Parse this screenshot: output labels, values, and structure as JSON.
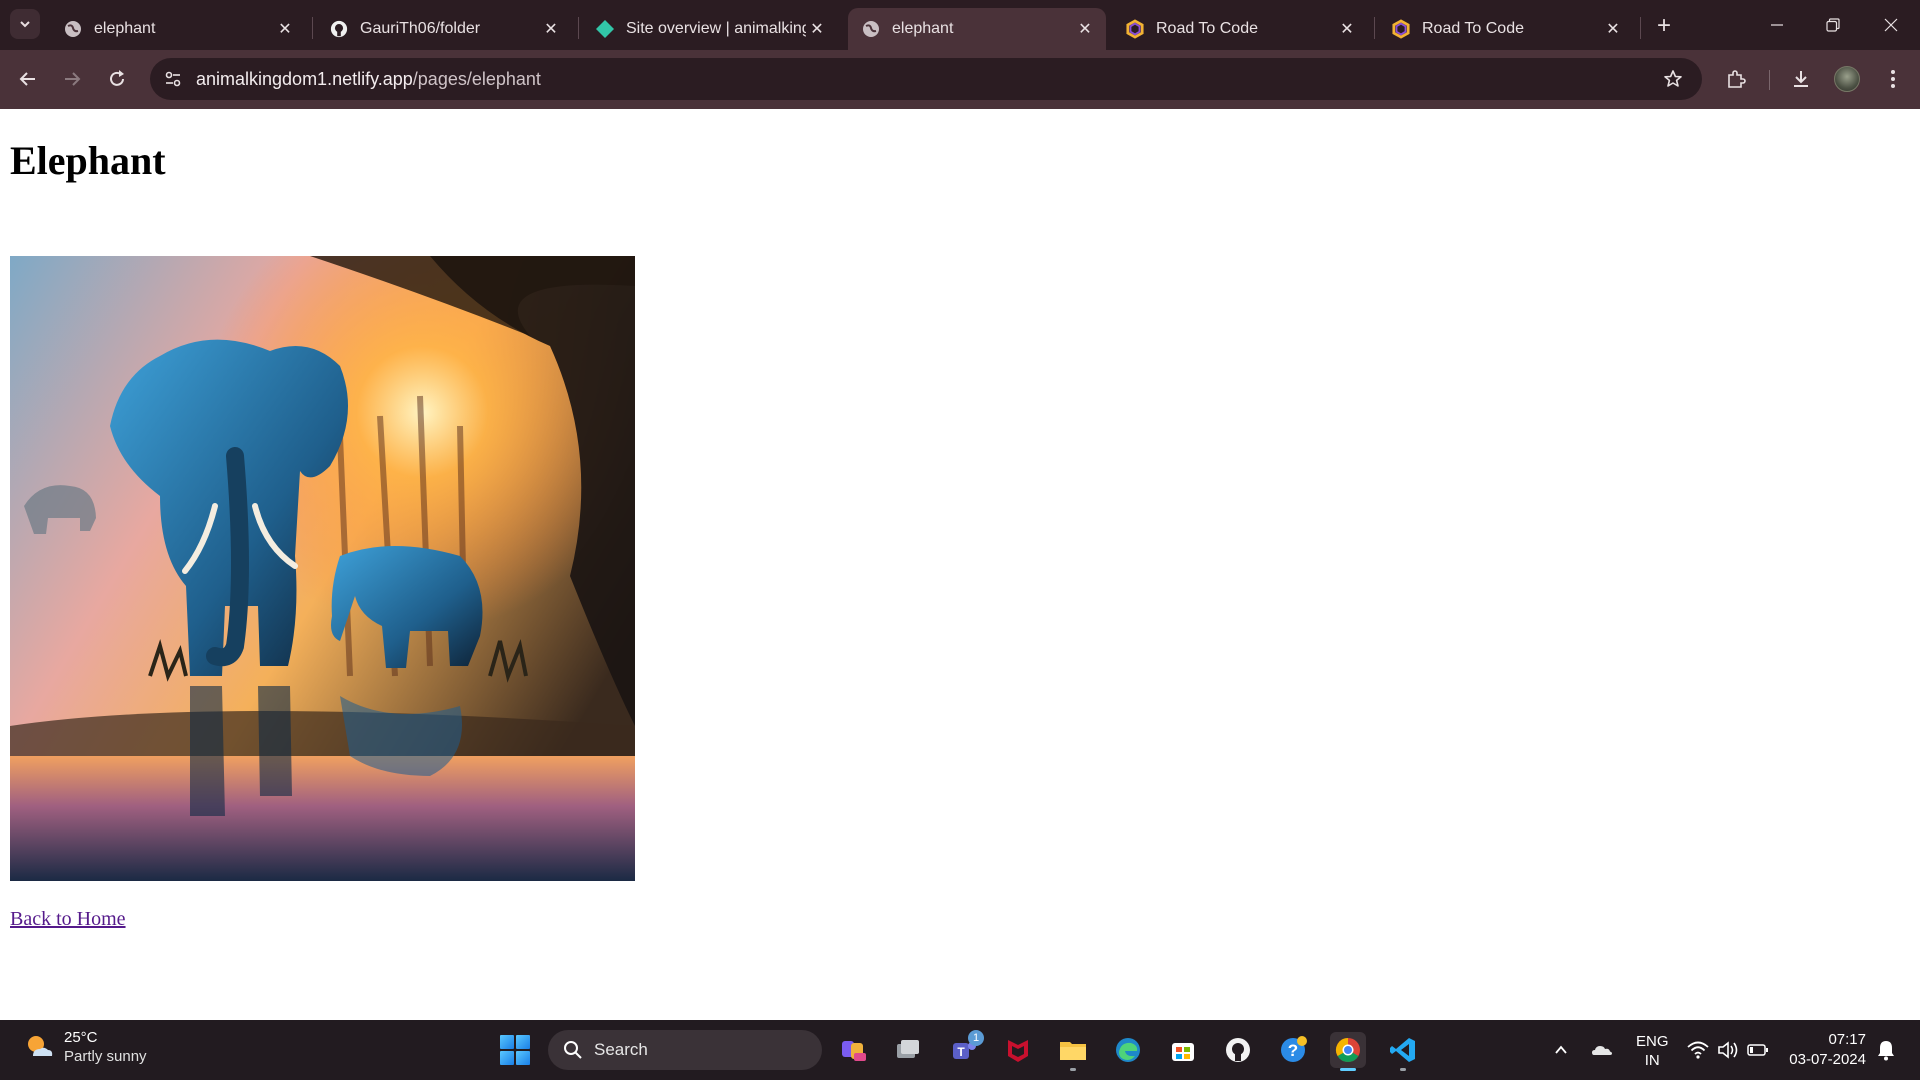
{
  "browser": {
    "tabs": [
      {
        "title": "elephant",
        "favicon": "globe-icon",
        "active": false
      },
      {
        "title": "GauriTh06/folder",
        "favicon": "github-icon",
        "active": false
      },
      {
        "title": "Site overview | animalkingd",
        "favicon": "netlify-icon",
        "active": false
      },
      {
        "title": "elephant",
        "favicon": "globe-icon",
        "active": true
      },
      {
        "title": "Road To Code",
        "favicon": "roadtocode-icon",
        "active": false
      },
      {
        "title": "Road To Code",
        "favicon": "roadtocode-icon",
        "active": false
      }
    ],
    "address": {
      "host": "animalkingdom1.netlify.app",
      "path": "/pages/elephant"
    }
  },
  "page": {
    "heading": "Elephant",
    "image_alt": "elephant painting",
    "back_link": "Back to Home"
  },
  "taskbar": {
    "weather": {
      "temp": "25°C",
      "desc": "Partly sunny"
    },
    "search_placeholder": "Search",
    "teams_badge": "1",
    "lang_line1": "ENG",
    "lang_line2": "IN",
    "time": "07:17",
    "date": "03-07-2024"
  },
  "colors": {
    "tab_strip": "#2b1c22",
    "toolbar": "#4a3239",
    "link_visited": "#551a8b",
    "taskbar": "#221b20"
  }
}
